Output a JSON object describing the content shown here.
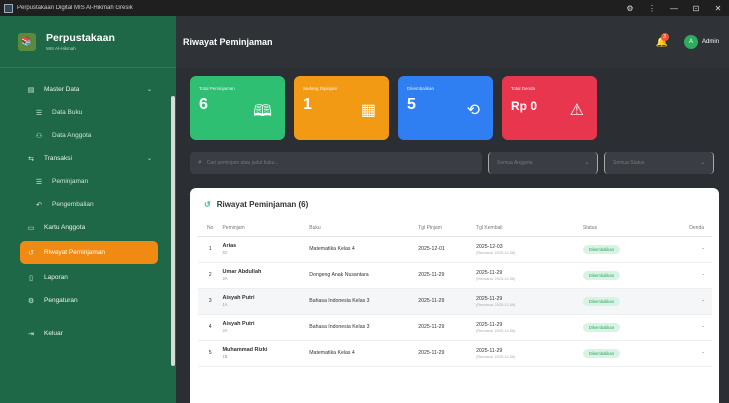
{
  "window": {
    "title": "Perpustakaan Digital MIS Al-Hikmah Gresik",
    "controls": [
      "⚙",
      "⋮",
      "—",
      "⊡",
      "✕"
    ]
  },
  "brand": {
    "name": "Perpustakaan",
    "sub": "MIS Al-Hikmah"
  },
  "sidebar": {
    "items": [
      {
        "label": "Master Data",
        "icon": "database-icon"
      },
      {
        "label": "Data Buku",
        "icon": "list-icon"
      },
      {
        "label": "Data Anggota",
        "icon": "users-icon"
      },
      {
        "label": "Transaksi",
        "icon": "swap-icon"
      },
      {
        "label": "Peminjaman",
        "icon": "list-icon"
      },
      {
        "label": "Pengembalian",
        "icon": "undo-icon"
      },
      {
        "label": "Kartu Anggota",
        "icon": "card-icon"
      },
      {
        "label": "Riwayat Peminjaman",
        "icon": "history-icon"
      },
      {
        "label": "Laporan",
        "icon": "document-icon"
      },
      {
        "label": "Pengaturan",
        "icon": "gear-icon"
      },
      {
        "label": "Keluar",
        "icon": "logout-icon"
      }
    ]
  },
  "header": {
    "title": "Riwayat Peminjaman",
    "notif_count": "3",
    "user": "Admin",
    "avatar_letter": "A"
  },
  "stats": [
    {
      "label": "Total Peminjaman",
      "value": "6",
      "color": "#2fbf72"
    },
    {
      "label": "Sedang Dipinjam",
      "value": "1",
      "color": "#f39a14"
    },
    {
      "label": "Dikembalikan",
      "value": "5",
      "color": "#2f7ff2"
    },
    {
      "label": "Total Denda",
      "value": "Rp 0",
      "color": "#e9364f"
    }
  ],
  "filters": {
    "search_placeholder": "Cari peminjam atau judul buku...",
    "member_select": "Semua Anggota",
    "status_select": "Semua Status"
  },
  "table": {
    "title": "Riwayat Peminjaman (6)",
    "headers": [
      "No",
      "Peminjam",
      "Buku",
      "Tgl Pinjam",
      "Tgl Kembali",
      "Status",
      "Denda"
    ],
    "rows": [
      {
        "no": "1",
        "name": "Arias",
        "cls": "6C",
        "book": "Matematika Kelas 4",
        "borrow": "2025-12-01",
        "ret": "2025-12-03",
        "ret_note": "(Rencana: 2025-12-08)",
        "status": "Dikembalikan",
        "fine": "-"
      },
      {
        "no": "2",
        "name": "Umar Abdullah",
        "cls": "2A",
        "book": "Dongeng Anak Nusantara",
        "borrow": "2025-11-29",
        "ret": "2025-11-29",
        "ret_note": "(Rencana: 2025-12-06)",
        "status": "Dikembalikan",
        "fine": "-"
      },
      {
        "no": "3",
        "name": "Aisyah Putri",
        "cls": "1A",
        "book": "Bahasa Indonesia Kelas 3",
        "borrow": "2025-11-29",
        "ret": "2025-11-29",
        "ret_note": "(Rencana: 2025-12-06)",
        "status": "Dikembalikan",
        "fine": "-"
      },
      {
        "no": "4",
        "name": "Aisyah Putri",
        "cls": "2A",
        "book": "Bahasa Indonesia Kelas 3",
        "borrow": "2025-11-29",
        "ret": "2025-11-29",
        "ret_note": "(Rencana: 2025-12-06)",
        "status": "Dikembalikan",
        "fine": "-"
      },
      {
        "no": "5",
        "name": "Muhammad Rizki",
        "cls": "1B",
        "book": "Matematika Kelas 4",
        "borrow": "2025-11-29",
        "ret": "2025-11-29",
        "ret_note": "(Rencana: 2025-12-06)",
        "status": "Dikembalikan",
        "fine": "-"
      }
    ]
  }
}
